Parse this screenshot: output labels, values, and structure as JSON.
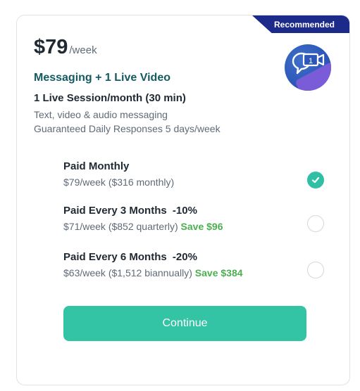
{
  "badge": "Recommended",
  "price": {
    "amount": "$79",
    "unit": "/week"
  },
  "plan": {
    "name": "Messaging + 1 Live Video",
    "session": "1 Live Session/month (30 min)",
    "features": [
      "Text, video & audio messaging",
      "Guaranteed Daily Responses 5 days/week"
    ]
  },
  "options": [
    {
      "title": "Paid Monthly",
      "discount": "",
      "sub": "$79/week ($316 monthly)",
      "save": "",
      "selected": true
    },
    {
      "title": "Paid Every 3 Months",
      "discount": "-10%",
      "sub": "$71/week ($852 quarterly)",
      "save": "Save $96",
      "selected": false
    },
    {
      "title": "Paid Every 6 Months",
      "discount": "-20%",
      "sub": "$63/week ($1,512 biannually)",
      "save": "Save $384",
      "selected": false
    }
  ],
  "continue_label": "Continue",
  "icons": {
    "plan": "video-chat-icon",
    "check": "check-icon"
  },
  "colors": {
    "accent": "#33c3a5",
    "badge": "#1c2a8a",
    "save": "#4caf50",
    "plan_name": "#145a62"
  }
}
